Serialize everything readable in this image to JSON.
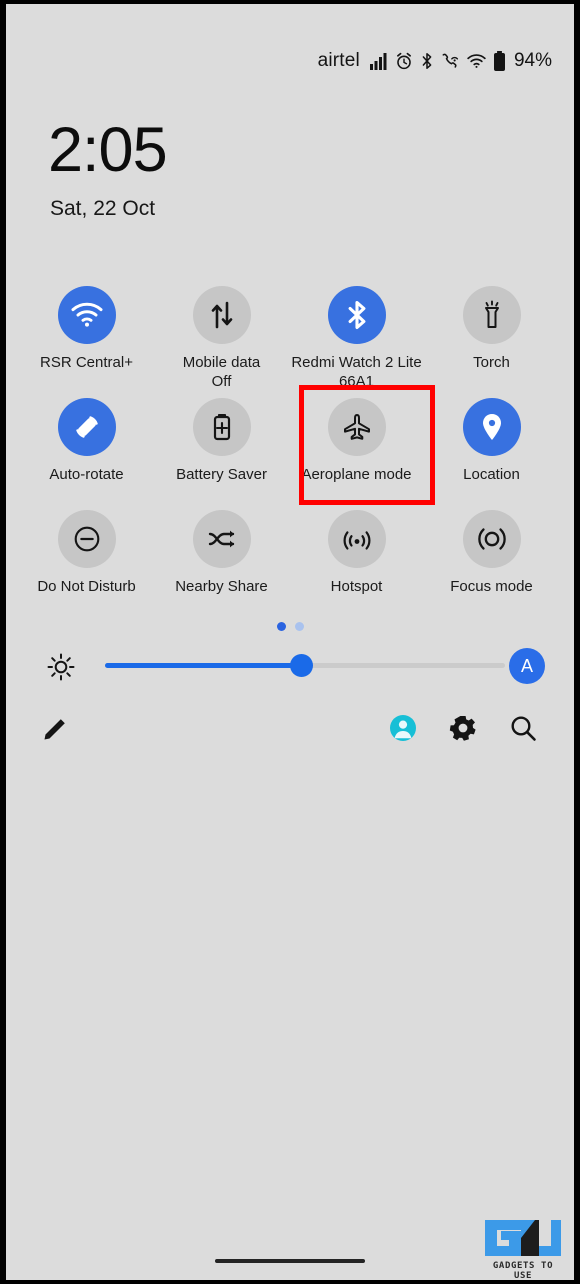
{
  "status_bar": {
    "carrier": "airtel",
    "battery_percent": "94%",
    "icons": [
      "signal-bars-icon",
      "alarm-icon",
      "bluetooth-icon",
      "call-wifi-icon",
      "wifi-icon",
      "battery-icon"
    ]
  },
  "clock": {
    "time": "2:05",
    "date": "Sat, 22 Oct"
  },
  "quick_settings": {
    "tiles": [
      {
        "label": "RSR Central+",
        "sub": "",
        "icon": "wifi-icon",
        "active": true
      },
      {
        "label": "Mobile data",
        "sub": "Off",
        "icon": "mobile-data-icon",
        "active": false
      },
      {
        "label": "Redmi Watch 2 Lite 66A1",
        "sub": "",
        "icon": "bluetooth-icon",
        "active": true
      },
      {
        "label": "Torch",
        "sub": "",
        "icon": "torch-icon",
        "active": false
      },
      {
        "label": "Auto-rotate",
        "sub": "",
        "icon": "auto-rotate-icon",
        "active": true
      },
      {
        "label": "Battery Saver",
        "sub": "",
        "icon": "battery-saver-icon",
        "active": false
      },
      {
        "label": "Aeroplane mode",
        "sub": "",
        "icon": "aeroplane-icon",
        "active": false
      },
      {
        "label": "Location",
        "sub": "",
        "icon": "location-pin-icon",
        "active": true
      },
      {
        "label": "Do Not Disturb",
        "sub": "",
        "icon": "do-not-disturb-icon",
        "active": false
      },
      {
        "label": "Nearby Share",
        "sub": "",
        "icon": "nearby-share-icon",
        "active": false
      },
      {
        "label": "Hotspot",
        "sub": "",
        "icon": "hotspot-icon",
        "active": false
      },
      {
        "label": "Focus mode",
        "sub": "",
        "icon": "focus-mode-icon",
        "active": false
      }
    ],
    "highlight": {
      "target_label": "Aeroplane mode",
      "color": "#ff0000"
    },
    "pages": {
      "count": 2,
      "current": 1
    }
  },
  "brightness": {
    "icon": "sun-icon",
    "value_percent": 49,
    "auto_label": "A",
    "fill_color": "#1a6ae8"
  },
  "footer": {
    "edit_icon": "pencil-icon",
    "user_icon": "user-avatar-icon",
    "settings_icon": "gear-icon",
    "search_icon": "search-icon"
  },
  "watermark": {
    "text": "GADGETS TO USE",
    "mark": "GU"
  },
  "colors": {
    "background": "#dcdcdc",
    "tile_off": "#c6c6c6",
    "tile_on": "#3871e0",
    "accent": "#1a6ae8",
    "highlight": "#ff0000"
  }
}
